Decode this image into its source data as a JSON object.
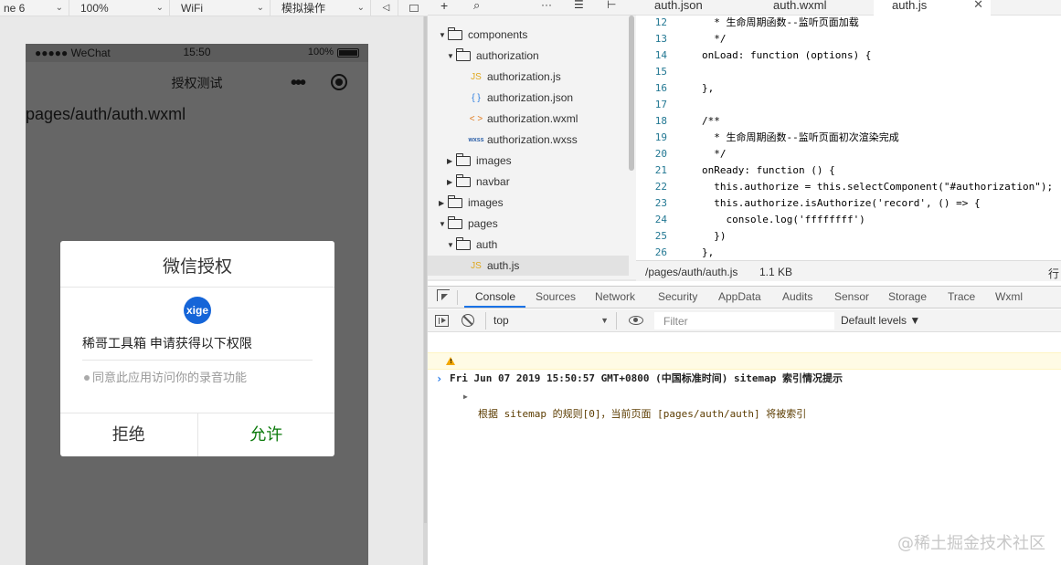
{
  "simulator": {
    "toolbar": {
      "device": "ne 6",
      "zoom": "100%",
      "network": "WiFi",
      "mode": "模拟操作"
    },
    "status_bar": {
      "carrier": "●●●●● WeChat",
      "time": "15:50",
      "battery": "100%"
    },
    "nav": {
      "title": "授权测试"
    },
    "page_path": "pages/auth/auth.wxml",
    "dialog": {
      "title": "微信授权",
      "logo_text": "xige",
      "app_request": "稀哥工具箱 申请获得以下权限",
      "permission": "同意此应用访问你的录音功能",
      "reject_label": "拒绝",
      "allow_label": "允许"
    }
  },
  "file_tree": {
    "items": [
      {
        "label": "components",
        "type": "folder",
        "expanded": true
      },
      {
        "label": "authorization",
        "type": "folder",
        "expanded": true
      },
      {
        "label": "authorization.js",
        "type": "js",
        "icon": "JS"
      },
      {
        "label": "authorization.json",
        "type": "json",
        "icon": "{ }"
      },
      {
        "label": "authorization.wxml",
        "type": "wxml",
        "icon": "< >"
      },
      {
        "label": "authorization.wxss",
        "type": "wxss",
        "icon": "wxss"
      },
      {
        "label": "images",
        "type": "folder",
        "expanded": false
      },
      {
        "label": "navbar",
        "type": "folder",
        "expanded": false
      },
      {
        "label": "images",
        "type": "folder",
        "expanded": false
      },
      {
        "label": "pages",
        "type": "folder",
        "expanded": true
      },
      {
        "label": "auth",
        "type": "folder",
        "expanded": true
      },
      {
        "label": "auth.js",
        "type": "js",
        "icon": "JS",
        "selected": true
      }
    ]
  },
  "editor": {
    "tabs": [
      {
        "label": "auth.json"
      },
      {
        "label": "auth.wxml"
      },
      {
        "label": "auth.js",
        "active": true,
        "close": "✕"
      }
    ],
    "lines": [
      {
        "n": "12",
        "text": "  * 生命周期函数--监听页面加载",
        "kind": "com"
      },
      {
        "n": "13",
        "text": "  */",
        "kind": "com"
      },
      {
        "n": "14",
        "text": "onLoad: function (options) {",
        "kind": "fn"
      },
      {
        "n": "15",
        "text": "",
        "kind": "plain"
      },
      {
        "n": "16",
        "text": "},",
        "kind": "plain"
      },
      {
        "n": "17",
        "text": "",
        "kind": "plain"
      },
      {
        "n": "18",
        "text": "/**",
        "kind": "com"
      },
      {
        "n": "19",
        "text": "  * 生命周期函数--监听页面初次渲染完成",
        "kind": "com"
      },
      {
        "n": "20",
        "text": "  */",
        "kind": "com"
      },
      {
        "n": "21",
        "text": "onReady: function () {",
        "kind": "fn"
      },
      {
        "n": "22",
        "text": "  this.authorize = this.selectComponent(\"#authorization\");",
        "kind": "plain"
      },
      {
        "n": "23",
        "text": "  this.authorize.isAuthorize('record', () => {",
        "kind": "plain"
      },
      {
        "n": "24",
        "text": "    console.log('ffffffff')",
        "kind": "plain"
      },
      {
        "n": "25",
        "text": "  })",
        "kind": "plain"
      },
      {
        "n": "26",
        "text": "},",
        "kind": "plain"
      }
    ],
    "status": {
      "path": "/pages/auth/auth.js",
      "size": "1.1 KB",
      "line_label": "行"
    }
  },
  "devtools": {
    "tabs": [
      "Console",
      "Sources",
      "Network",
      "Security",
      "AppData",
      "Audits",
      "Sensor",
      "Storage",
      "Trace",
      "Wxml"
    ],
    "active_tab": "Console",
    "context": "top",
    "filter_placeholder": "Filter",
    "levels": "Default levels ▼",
    "logs": {
      "group": "Fri Jun 07 2019 15:50:57 GMT+0800 (中国标准时间) sitemap 索引情况提示",
      "warning": "根据 sitemap 的规则[0]，当前页面 [pages/auth/auth] 将被索引"
    },
    "prompt": "›"
  },
  "watermark": "@稀土掘金技术社区",
  "colors": {
    "allow_green": "#0b7a0b",
    "logo_blue": "#1565d8",
    "tab_underline": "#1a73e8",
    "warning_bg": "#fffbe5"
  }
}
